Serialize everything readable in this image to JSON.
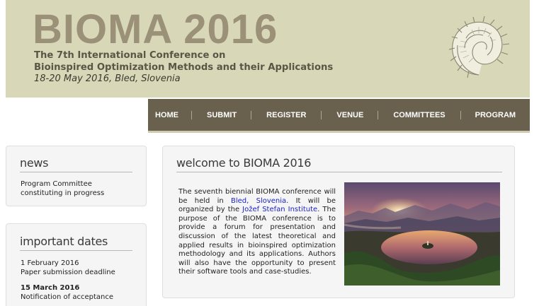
{
  "header": {
    "brand": "BIOMA 2016",
    "conference_line1": "The 7th International Conference on",
    "conference_line2": "Bioinspired Optimization Methods and their Applications",
    "date_place": "18-20 May 2016, Bled, Slovenia",
    "logo_icon": "ammonite-shell-icon"
  },
  "nav": {
    "items": [
      "HOME",
      "SUBMIT",
      "REGISTER",
      "VENUE",
      "COMMITTEES",
      "PROGRAM"
    ],
    "separator": "|"
  },
  "news": {
    "title": "news",
    "line1": "Program Committee",
    "line2": "constituting in progress"
  },
  "important_dates": {
    "title": "important dates",
    "entries": [
      {
        "date": "1 February 2016",
        "label": "Paper submission deadline"
      },
      {
        "date": "15 March 2016",
        "label": "Notification of acceptance"
      }
    ]
  },
  "welcome": {
    "title": "welcome to BIOMA 2016",
    "text_part1": "The seventh biennial BIOMA conference will be held in ",
    "link_bled": "Bled, Slovenia",
    "text_part2": ". It will be organized by the ",
    "link_institute": "Jožef Stefan Institute",
    "text_part3": ". The purpose of the BIOMA conference is to provide a forum for presentation and discussion of the latest theoretical and applied results in bioinspired optimization methodology and its applications. Authors will also have the opportunity to present their software tools and case-studies.",
    "photo_icon": "lake-bled-photo"
  },
  "colors": {
    "header_bg": "#d8d8b8",
    "brand": "#9a9178",
    "nav_bg": "#69604e",
    "link": "#1a23c8"
  }
}
